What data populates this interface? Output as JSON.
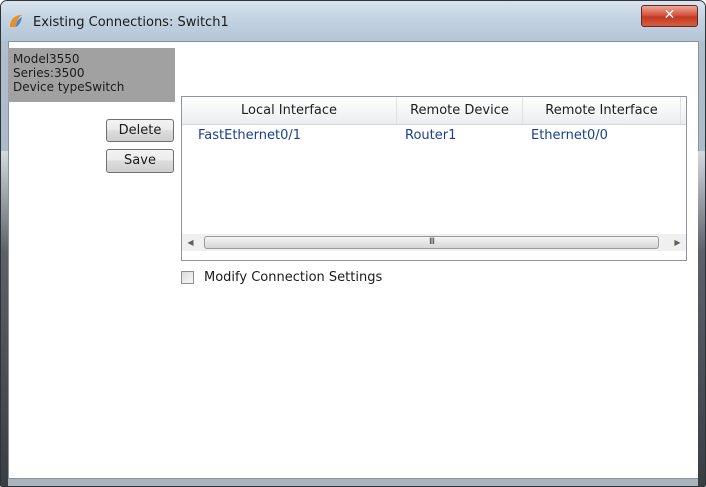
{
  "window": {
    "title": "Existing Connections: Switch1",
    "close_glyph": "✕"
  },
  "device": {
    "model": "Model3550",
    "series": "Series:3500",
    "type": "Device typeSwitch"
  },
  "buttons": {
    "delete_label": "Delete",
    "save_label": "Save"
  },
  "table": {
    "columns": [
      "Local Interface",
      "Remote Device",
      "Remote Interface"
    ],
    "rows": [
      {
        "local_interface": "FastEthernet0/1",
        "remote_device": "Router1",
        "remote_interface": "Ethernet0/0"
      }
    ]
  },
  "scrollbar": {
    "left_arrow": "◀",
    "right_arrow": "▶",
    "thumb_grip": "III"
  },
  "options": {
    "modify_label": "Modify Connection Settings",
    "modify_checked": false
  },
  "colors": {
    "link_text": "#1a3f8f",
    "device_panel": "#a1a1a1",
    "close_button": "#c13a22"
  }
}
